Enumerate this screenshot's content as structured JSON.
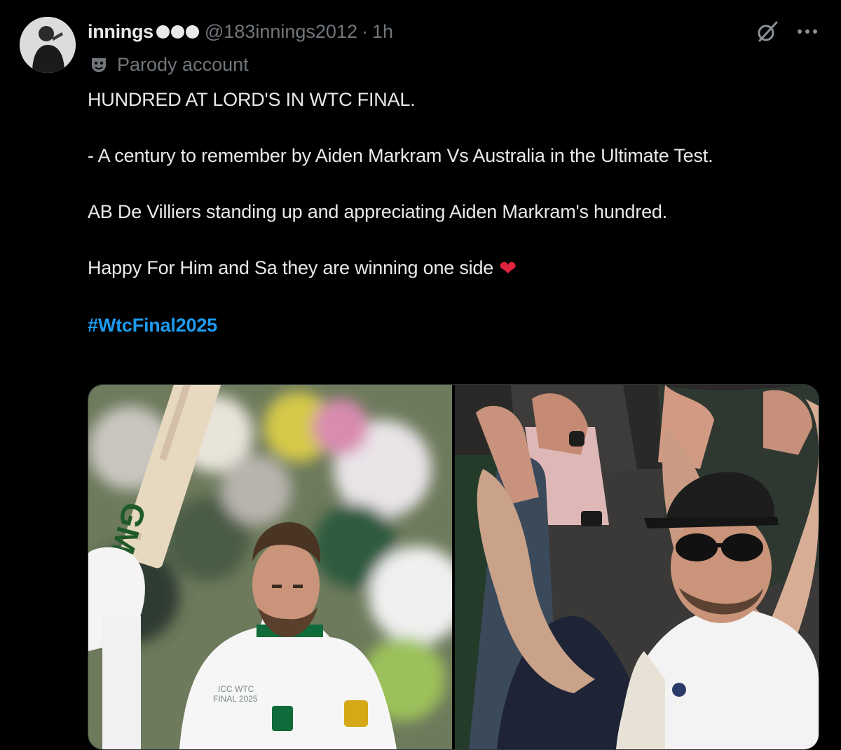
{
  "tweet": {
    "display_name": "innings",
    "handle": "@183innings2012",
    "separator": "·",
    "time": "1h",
    "label": "Parody account",
    "lines": [
      "HUNDRED AT LORD'S IN WTC FINAL.",
      "- A century to remember by Aiden Markram Vs Australia in the Ultimate Test.",
      "AB De Villiers standing up and appreciating Aiden Markram's hundred.",
      "Happy For Him and Sa they are winning one side"
    ],
    "emoji": "❤",
    "hashtag": "#WtcFinal2025"
  },
  "media": {
    "images": [
      {
        "bat_brand": "GM",
        "shirt_text": "ICC WTC FINAL 2025"
      },
      {}
    ]
  },
  "icons": {
    "avatar": "profile-photo",
    "badge": "circle-dots-badge",
    "parody": "theater-mask-icon",
    "grok": "grok-icon",
    "more": "more-options-icon"
  },
  "colors": {
    "background": "#000000",
    "text": "#e7e9ea",
    "muted": "#71767b",
    "link": "#1d9bf0",
    "heart": "#e0243d"
  }
}
